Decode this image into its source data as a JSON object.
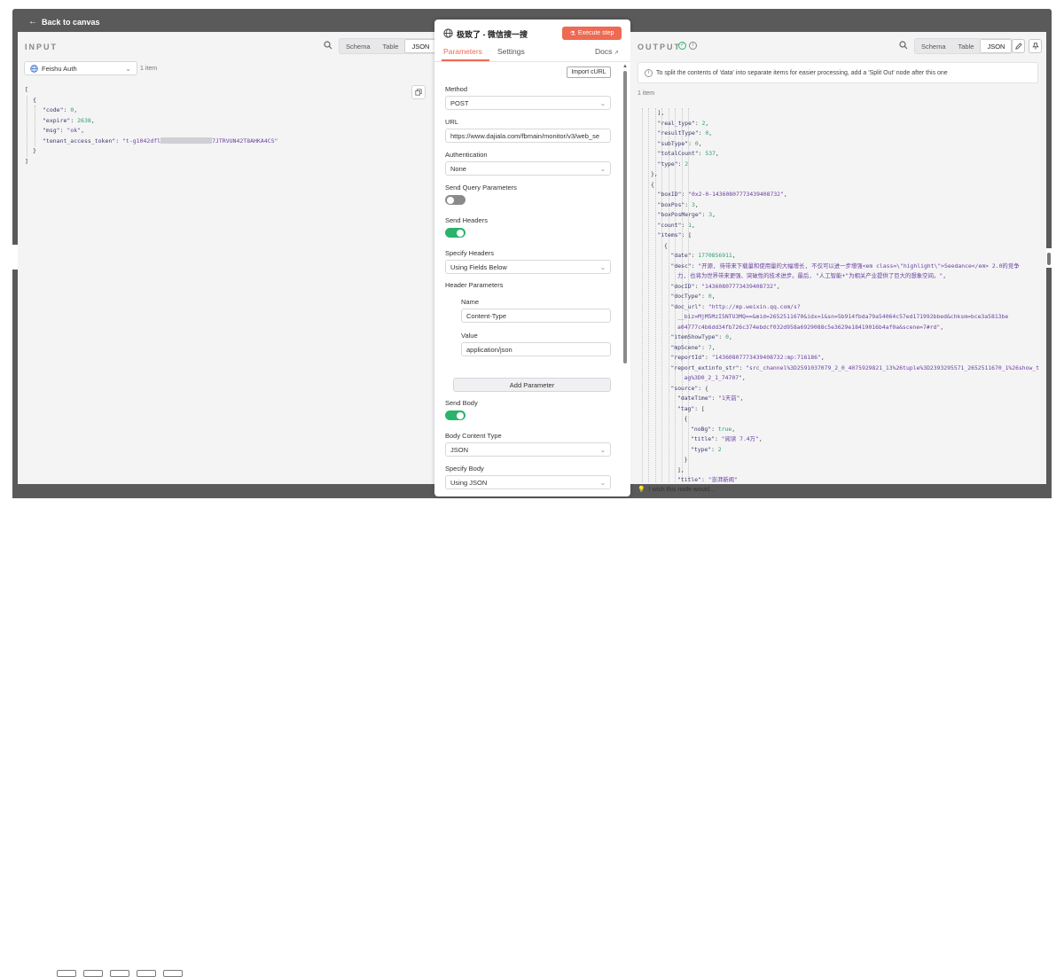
{
  "canvas": {
    "back_label": "Back to canvas"
  },
  "input_panel": {
    "label": "INPUT",
    "view_tabs": [
      "Schema",
      "Table",
      "JSON"
    ],
    "active_view": "JSON",
    "node_select": "Feishu Auth",
    "item_count": "1 item",
    "json": {
      "code_key": "\"code\"",
      "code_val": "0",
      "expire_key": "\"expire\"",
      "expire_val": "2638",
      "msg_key": "\"msg\"",
      "msg_val": "\"ok\"",
      "token_key": "\"tenant_access_token\"",
      "token_prefix": "\"t-g1042dfl",
      "token_suffix": "7JTRVUN42T8AHKA4CS\""
    }
  },
  "node": {
    "title": "极致了 - 微信搜一搜",
    "execute_label": "Execute step",
    "tabs": {
      "parameters": "Parameters",
      "settings": "Settings",
      "docs": "Docs"
    },
    "import_curl": "Import cURL",
    "method": {
      "label": "Method",
      "value": "POST"
    },
    "url": {
      "label": "URL",
      "value": "https://www.dajiala.com/fbmain/monitor/v3/web_se"
    },
    "authentication": {
      "label": "Authentication",
      "value": "None"
    },
    "send_query": {
      "label": "Send Query Parameters",
      "enabled": false
    },
    "send_headers": {
      "label": "Send Headers",
      "enabled": true
    },
    "specify_headers": {
      "label": "Specify Headers",
      "value": "Using Fields Below"
    },
    "header_params": {
      "label": "Header Parameters",
      "name_label": "Name",
      "name_value": "Content-Type",
      "value_label": "Value",
      "value_value": "application/json",
      "add_label": "Add Parameter"
    },
    "send_body": {
      "label": "Send Body",
      "enabled": true
    },
    "body_content_type": {
      "label": "Body Content Type",
      "value": "JSON"
    },
    "specify_body": {
      "label": "Specify Body",
      "value": "Using JSON"
    }
  },
  "output_panel": {
    "label": "OUTPUT",
    "view_tabs": [
      "Schema",
      "Table",
      "JSON"
    ],
    "active_view": "JSON",
    "hint": "To split the contents of 'data' into separate items for easier processing, add a 'Split Out' node after this one",
    "item_count": "1 item",
    "wish": "I wish this node would...",
    "json_lines": [
      {
        "d": 3,
        "t": "],"
      },
      {
        "d": 3,
        "k": "\"real_type\"",
        "v": "2",
        "c": "n",
        "end": ","
      },
      {
        "d": 3,
        "k": "\"resultType\"",
        "v": "0",
        "c": "n",
        "end": ","
      },
      {
        "d": 3,
        "k": "\"subType\"",
        "v": "0",
        "c": "n",
        "end": ","
      },
      {
        "d": 3,
        "k": "\"totalCount\"",
        "v": "537",
        "c": "n",
        "end": ","
      },
      {
        "d": 3,
        "k": "\"type\"",
        "v": "2",
        "c": "n",
        "end": ""
      },
      {
        "d": 2,
        "t": "},"
      },
      {
        "d": 2,
        "t": "{"
      },
      {
        "d": 3,
        "k": "\"boxID\"",
        "v": "\"0x2-0-14360807773439408732\"",
        "c": "s",
        "end": ","
      },
      {
        "d": 3,
        "k": "\"boxPos\"",
        "v": "3",
        "c": "n",
        "end": ","
      },
      {
        "d": 3,
        "k": "\"boxPosMerge\"",
        "v": "3",
        "c": "n",
        "end": ","
      },
      {
        "d": 3,
        "k": "\"count\"",
        "v": "1",
        "c": "n",
        "end": ","
      },
      {
        "d": 3,
        "k": "\"items\"",
        "v": "[",
        "c": "",
        "end": ""
      },
      {
        "d": 4,
        "t": "{"
      },
      {
        "d": 5,
        "k": "\"date\"",
        "v": "1770856911",
        "c": "n",
        "end": ","
      },
      {
        "d": 5,
        "k": "\"desc\"",
        "v": "\"开源, 待带来下载量和使用量的大幅增长, 不仅可以进一步增强<em class=\\\"highlight\\\">Seedance</em> 2.0的竞争",
        "c": "s",
        "end": ""
      },
      {
        "d": 6,
        "v": "力, 也将为世界带来更强、突破性的技术进步。最后, \"人工智能+\"为相关产业提供了巨大的想象空间。\"",
        "c": "s",
        "end": ","
      },
      {
        "d": 5,
        "k": "\"docID\"",
        "v": "\"14360807773439408732\"",
        "c": "s",
        "end": ","
      },
      {
        "d": 5,
        "k": "\"docType\"",
        "v": "0",
        "c": "n",
        "end": ","
      },
      {
        "d": 5,
        "k": "\"doc_url\"",
        "v": "\"http://mp.weixin.qq.com/s?",
        "c": "s",
        "end": ""
      },
      {
        "d": 6,
        "v": "__biz=MjM5MzI5NTU3MQ==&mid=2652511670&idx=1&sn=5b914fbda79a54064c57ed171992bbed&chksm=bce3a5813be",
        "c": "s",
        "end": ""
      },
      {
        "d": 6,
        "v": "a04777c4b6dd34fb726c374ebdcf032d958a6929088c5e3629e18419016b4af0a&scene=7#rd\"",
        "c": "s",
        "end": ","
      },
      {
        "d": 5,
        "k": "\"itemShowType\"",
        "v": "0",
        "c": "n",
        "end": ","
      },
      {
        "d": 5,
        "k": "\"mpScene\"",
        "v": "7",
        "c": "n",
        "end": ","
      },
      {
        "d": 5,
        "k": "\"reportId\"",
        "v": "\"14360807773439408732:mp:716186\"",
        "c": "s",
        "end": ","
      },
      {
        "d": 5,
        "k": "\"report_extinfo_str\"",
        "v": "\"src_channel%3D2591037079_2_0_4075929821_13%26tuple%3D2393295571_2652511670_1%26show_t",
        "c": "s",
        "end": ""
      },
      {
        "d": 7,
        "v": "ag%3D0_2_1_74707\"",
        "c": "s",
        "end": ","
      },
      {
        "d": 5,
        "k": "\"source\"",
        "v": "{",
        "c": "",
        "end": ""
      },
      {
        "d": 6,
        "k": "\"dateTime\"",
        "v": "\"1天前\"",
        "c": "s",
        "end": ","
      },
      {
        "d": 6,
        "k": "\"tag\"",
        "v": "[",
        "c": "",
        "end": ""
      },
      {
        "d": 7,
        "t": "{"
      },
      {
        "d": 8,
        "k": "\"noBg\"",
        "v": "true",
        "c": "b",
        "end": ","
      },
      {
        "d": 8,
        "k": "\"title\"",
        "v": "\"阅读 7.4万\"",
        "c": "s",
        "end": ","
      },
      {
        "d": 8,
        "k": "\"type\"",
        "v": "2",
        "c": "n",
        "end": ""
      },
      {
        "d": 7,
        "t": "}"
      },
      {
        "d": 6,
        "t": "],"
      },
      {
        "d": 6,
        "k": "\"title\"",
        "v": "\"澎湃新闻\"",
        "c": "s",
        "end": ""
      }
    ]
  },
  "colors": {
    "accent": "#ee6a52",
    "toggle_on": "#2ab36b",
    "toggle_off": "#8a8a8a"
  }
}
